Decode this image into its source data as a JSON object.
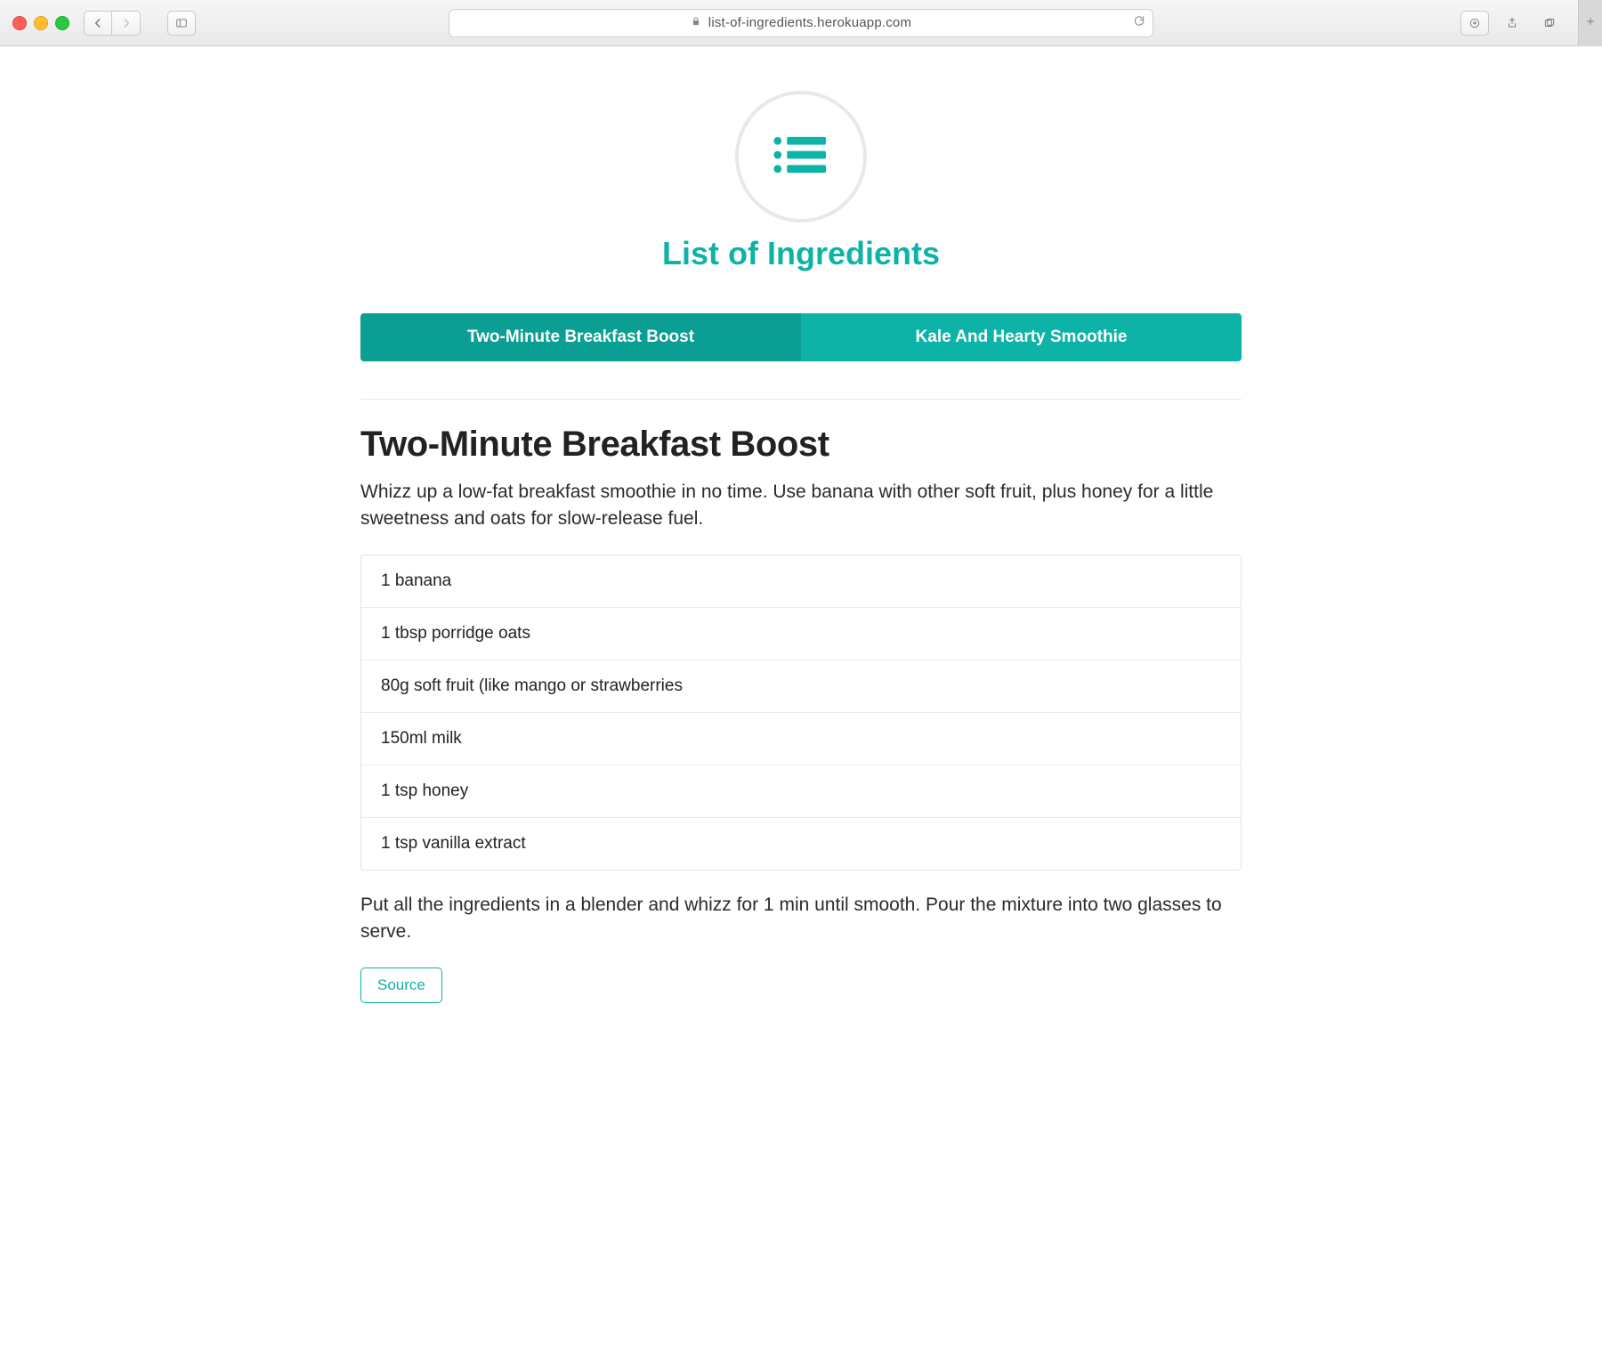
{
  "browser": {
    "url": "list-of-ingredients.herokuapp.com",
    "icons": {
      "back": "chevron-left-icon",
      "forward": "chevron-right-icon",
      "sidebar": "sidebar-toggle-icon",
      "lock": "lock-icon",
      "reload": "reload-icon",
      "downloads": "download-icon",
      "share": "share-icon",
      "tabs": "tabs-overview-icon",
      "new_tab": "plus-icon"
    }
  },
  "brand": {
    "title": "List of Ingredients",
    "icon": "list-icon"
  },
  "accent_color": "#0db3a6",
  "tabs": [
    {
      "label": "Two-Minute Breakfast Boost",
      "active": true
    },
    {
      "label": "Kale And Hearty Smoothie",
      "active": false
    }
  ],
  "recipe": {
    "title": "Two-Minute Breakfast Boost",
    "description": "Whizz up a low-fat breakfast smoothie in no time. Use banana with other soft fruit, plus honey for a little sweetness and oats for slow-release fuel.",
    "ingredients": [
      "1 banana",
      "1 tbsp porridge oats",
      "80g soft fruit (like mango or strawberries",
      "150ml milk",
      "1 tsp honey",
      "1 tsp vanilla extract"
    ],
    "instructions": "Put all the ingredients in a blender and whizz for 1 min until smooth. Pour the mixture into two glasses to serve.",
    "source_label": "Source"
  }
}
